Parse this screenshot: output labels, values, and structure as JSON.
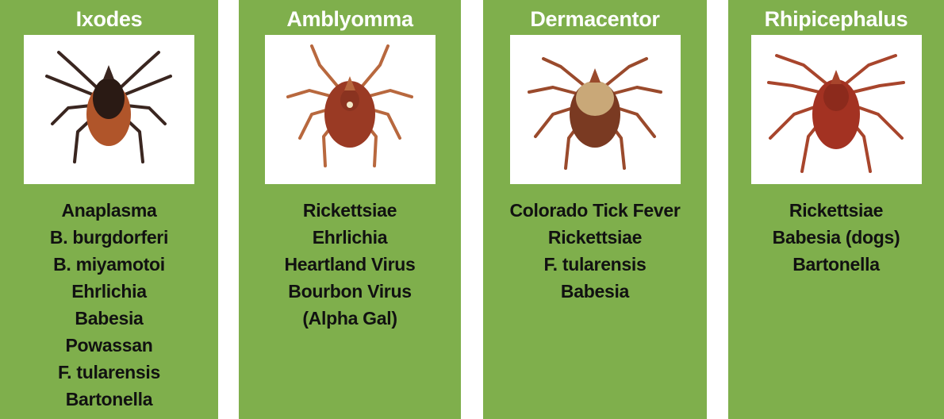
{
  "cards": [
    {
      "genus": "Ixodes",
      "colors": {
        "body": "#b0552a",
        "shield": "#2a1a14",
        "legs": "#3a2620"
      },
      "diseases": [
        "Anaplasma",
        "B. burgdorferi",
        "B. miyamotoi",
        "Ehrlichia",
        "Babesia",
        "Powassan",
        "F. tularensis",
        "Bartonella"
      ]
    },
    {
      "genus": "Amblyomma",
      "colors": {
        "body": "#9a3a24",
        "shield": "#8a3320",
        "legs": "#b8683e"
      },
      "diseases": [
        "Rickettsiae",
        "Ehrlichia",
        "Heartland Virus",
        "Bourbon Virus",
        "(Alpha Gal)"
      ]
    },
    {
      "genus": "Dermacentor",
      "colors": {
        "body": "#7a3a22",
        "shield": "#c9a878",
        "legs": "#9a4a2c"
      },
      "diseases": [
        "Colorado Tick Fever",
        "Rickettsiae",
        "F. tularensis",
        "Babesia"
      ]
    },
    {
      "genus": "Rhipicephalus",
      "colors": {
        "body": "#a33222",
        "shield": "#8c2a1c",
        "legs": "#a8452c"
      },
      "diseases": [
        "Rickettsiae",
        "Babesia (dogs)",
        "Bartonella"
      ]
    }
  ]
}
